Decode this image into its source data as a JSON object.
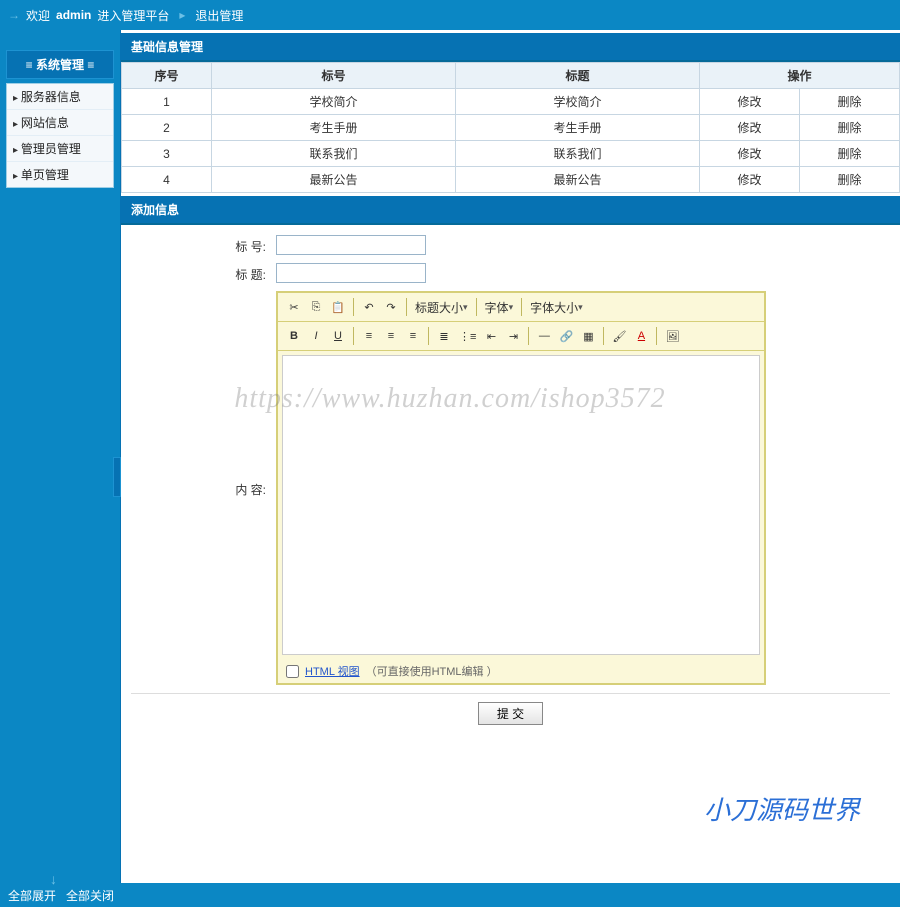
{
  "topbar": {
    "welcome_prefix": "欢迎",
    "user": "admin",
    "welcome_suffix": "进入管理平台",
    "logout": "退出管理"
  },
  "sidebar": {
    "header": "≡ 系统管理 ≡",
    "items": [
      {
        "label": "服务器信息"
      },
      {
        "label": "网站信息"
      },
      {
        "label": "管理员管理"
      },
      {
        "label": "单页管理"
      }
    ]
  },
  "section_basic": {
    "title": "基础信息管理",
    "columns": {
      "index": "序号",
      "number": "标号",
      "title": "标题",
      "action": "操作"
    },
    "rows": [
      {
        "index": "1",
        "number": "学校简介",
        "title": "学校简介",
        "edit": "修改",
        "delete": "删除"
      },
      {
        "index": "2",
        "number": "考生手册",
        "title": "考生手册",
        "edit": "修改",
        "delete": "删除"
      },
      {
        "index": "3",
        "number": "联系我们",
        "title": "联系我们",
        "edit": "修改",
        "delete": "删除"
      },
      {
        "index": "4",
        "number": "最新公告",
        "title": "最新公告",
        "edit": "修改",
        "delete": "删除"
      }
    ]
  },
  "section_add": {
    "title": "添加信息",
    "labels": {
      "number": "标 号:",
      "title": "标 题:",
      "content": "内 容:"
    },
    "values": {
      "number": "",
      "title": ""
    }
  },
  "editor": {
    "dropdowns": {
      "heading": "标题大小",
      "font": "字体",
      "fontsize": "字体大小"
    },
    "footer_link": "HTML 视图",
    "footer_hint": "（可直接使用HTML编辑 ）"
  },
  "submit_label": "提 交",
  "bottombar": {
    "expand": "全部展开",
    "collapse": "全部关闭"
  },
  "watermark": "https://www.huzhan.com/ishop3572",
  "brand": "小刀源码世界"
}
